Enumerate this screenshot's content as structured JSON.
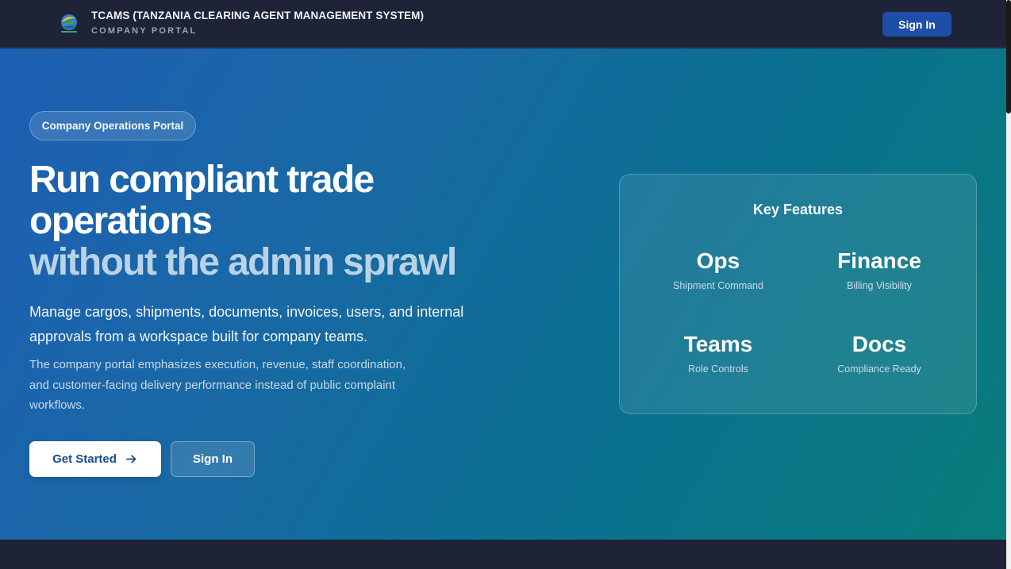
{
  "header": {
    "title": "TCAMS (TANZANIA CLEARING AGENT MANAGEMENT SYSTEM)",
    "subtitle": "COMPANY PORTAL",
    "signin_label": "Sign In"
  },
  "hero": {
    "pill": "Company Operations Portal",
    "headline_line1": "Run compliant trade",
    "headline_line2": "operations",
    "headline_line3": "without the admin sprawl",
    "lead": "Manage cargos, shipments, documents, invoices, users, and internal approvals from a workspace built for company teams.",
    "description": "The company portal emphasizes execution, revenue, staff coordination, and customer-facing delivery performance instead of public complaint workflows.",
    "get_started_label": "Get Started",
    "signin_label": "Sign In"
  },
  "features": {
    "title": "Key Features",
    "items": [
      {
        "title": "Ops",
        "subtitle": "Shipment Command"
      },
      {
        "title": "Finance",
        "subtitle": "Billing Visibility"
      },
      {
        "title": "Teams",
        "subtitle": "Role Controls"
      },
      {
        "title": "Docs",
        "subtitle": "Compliance Ready"
      }
    ]
  },
  "icons": {
    "logo": "logo-icon",
    "arrow": "arrow-right-icon"
  },
  "colors": {
    "header_bg": "#1e2337",
    "accent": "#1d4fa8",
    "hero_start": "#1d5fb3",
    "hero_end": "#087c7a"
  }
}
